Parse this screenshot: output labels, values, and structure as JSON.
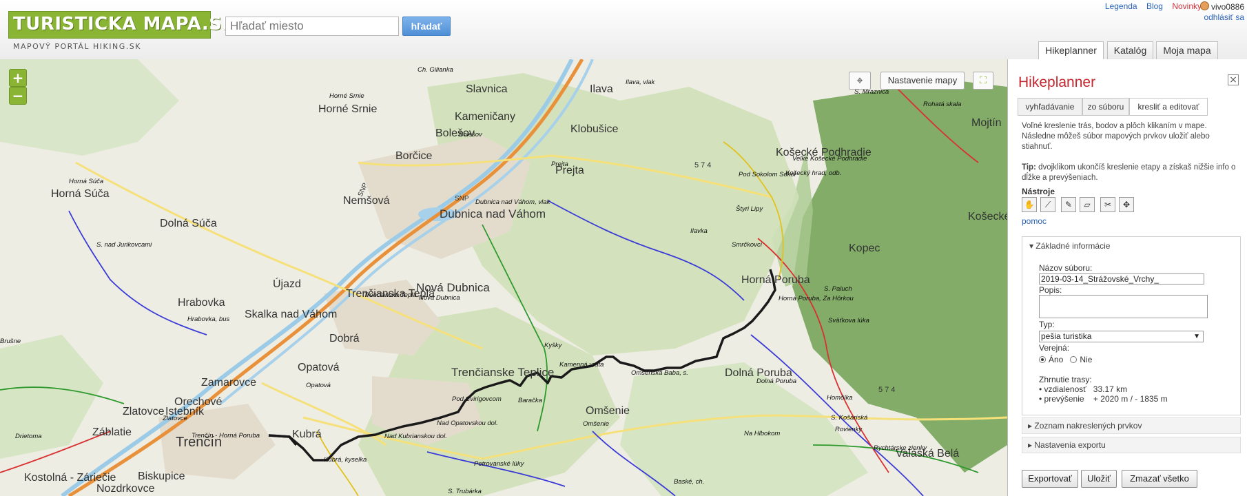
{
  "header": {
    "logo_text": "TURISTICKA MAPA.SK",
    "subtitle": "MAPOVÝ PORTÁL HIKING.SK",
    "search_placeholder": "Hľadať miesto",
    "search_button": "hľadať",
    "links": [
      "Legenda",
      "Blog",
      "Novinky"
    ],
    "user_name": "vivo0886",
    "logout": "odhlásiť sa",
    "tabs": [
      {
        "label": "Hikeplanner",
        "active": true
      },
      {
        "label": "Katalóg",
        "active": false
      },
      {
        "label": "Moja mapa",
        "active": false
      }
    ]
  },
  "map": {
    "zoom_in": "+",
    "zoom_out": "−",
    "settings_button": "Nastavenie mapy",
    "locate_icon": "crosshair-icon",
    "fullscreen_icon": "fullscreen-icon",
    "towns": [
      {
        "name": "Slavnica",
        "size": "big"
      },
      {
        "name": "Ilava",
        "size": "big"
      },
      {
        "name": "Horné Srnie",
        "size": "big"
      },
      {
        "name": "Kameničany",
        "size": "big"
      },
      {
        "name": "Klobušice",
        "size": "big"
      },
      {
        "name": "Bolešov",
        "size": "big"
      },
      {
        "name": "Borčice",
        "size": "big"
      },
      {
        "name": "Košecké Podhradie",
        "size": "big"
      },
      {
        "name": "Horná Súča",
        "size": "big"
      },
      {
        "name": "Nemšová",
        "size": "big"
      },
      {
        "name": "Dubnica nad Váhom",
        "size": "big"
      },
      {
        "name": "Prejta",
        "size": "big"
      },
      {
        "name": "Dolná Súča",
        "size": "big"
      },
      {
        "name": "Košecké",
        "size": "big"
      },
      {
        "name": "Kopec",
        "size": "big"
      },
      {
        "name": "Horná Poruba",
        "size": "big"
      },
      {
        "name": "Újazd",
        "size": "big"
      },
      {
        "name": "Nová Dubnica",
        "size": "big"
      },
      {
        "name": "Trenčianska Teplá",
        "size": "big"
      },
      {
        "name": "Hrabovka",
        "size": "big"
      },
      {
        "name": "Skalka nad Váhom",
        "size": "big"
      },
      {
        "name": "Dobrá",
        "size": "big"
      },
      {
        "name": "Opatová",
        "size": "big"
      },
      {
        "name": "Zamarovce",
        "size": "big"
      },
      {
        "name": "Trenčianske Teplice",
        "size": "big"
      },
      {
        "name": "Dolná Poruba",
        "size": "big"
      },
      {
        "name": "Orechové",
        "size": "big"
      },
      {
        "name": "Zlatovce",
        "size": "big"
      },
      {
        "name": "Istebník",
        "size": "big"
      },
      {
        "name": "Omšenie",
        "size": "big"
      },
      {
        "name": "Záblatie",
        "size": "big"
      },
      {
        "name": "Trenčín",
        "size": "big"
      },
      {
        "name": "Kubrá",
        "size": "big"
      },
      {
        "name": "Kostolná - Záriečie",
        "size": "big"
      },
      {
        "name": "Biskupice",
        "size": "big"
      },
      {
        "name": "Nozdrkovce",
        "size": "big"
      },
      {
        "name": "Valaská Belá",
        "size": "big"
      },
      {
        "name": "Mojtín",
        "size": "big"
      }
    ],
    "stops": [
      "Ch. Gilianka",
      "Ilava, vlak",
      "S. Mraznica",
      "Horné Srnie",
      "Rohatá skala",
      "Bolešov",
      "Prejta",
      "Velké Košecké Podhradie",
      "Košecký hrad, odb.",
      "Pod Sokolom Sokol",
      "Horná Súča",
      "Dubnica nad Váhom, vlak",
      "Štyri Lipy",
      "Ilavka",
      "Smrčkovci",
      "S. nad Jurikovcami",
      "S. Paluch",
      "Horná Poruba, Za Hôrkou",
      "Trenčianska Teplá",
      "Nová Dubnica",
      "Hrabovka, bus",
      "Sväťkova lúka",
      "Brušne",
      "Kyšky",
      "Kamenná vrata",
      "Omšenská Baba, s.",
      "Opatová",
      "Dolná Poruba",
      "Pod Cvirigovcom",
      "Baračka",
      "Homôlka",
      "Zlatovce",
      "Drietoma",
      "Trenčín - Horná Poruba",
      "Nad Opatovskou dol.",
      "Nad Kubrianskou dol.",
      "Omšenie",
      "S. Košariská",
      "Rovienky",
      "Kubrá, kyselka",
      "Petrovanské lúky",
      "Na Hlbokom",
      "Rychtárske zienky",
      "Baské, ch.",
      "S. Trubárka"
    ],
    "route_marks": [
      "SNP",
      "574"
    ]
  },
  "panel": {
    "title": "Hikeplanner",
    "close_icon": "close-icon",
    "tabs": [
      {
        "label": "vyhľadávanie",
        "active": false
      },
      {
        "label": "zo súboru",
        "active": false
      },
      {
        "label": "kresliť a editovať",
        "active": true
      }
    ],
    "intro": "Voľné kreslenie trás, bodov a plôch klikaním v mape. Následne môžeš súbor mapových prvkov uložiť alebo stiahnuť.",
    "tip_label": "Tip:",
    "tip_text": "dvojklikom ukončíš kreslenie etapy a získaš nižšie info o dĺžke a prevýšeniach.",
    "tools_label": "Nástroje",
    "tools": [
      "hand-icon",
      "polyline-icon",
      "draw-line-icon",
      "polygon-icon",
      "scissors-icon",
      "move-icon"
    ],
    "help": "pomoc",
    "basic_info": {
      "title": "Základné informácie",
      "file_name_label": "Názov súboru:",
      "file_name_value": "2019-03-14_Strážovské_Vrchy_",
      "description_label": "Popis:",
      "description_value": "",
      "type_label": "Typ:",
      "type_value": "pešia turistika",
      "public_label": "Verejná:",
      "public_yes": "Áno",
      "public_no": "Nie",
      "public_selected": "yes",
      "summary_label": "Zhrnutie trasy:",
      "distance_label": "• vzdialenosť",
      "distance_value": "33.17 km",
      "elevation_label": "• prevýšenie",
      "elevation_value": "+ 2020 m / - 1835 m"
    },
    "sections": [
      "Zoznam nakreslených prvkov",
      "Nastavenia exportu"
    ],
    "buttons": [
      "Exportovať",
      "Uložiť",
      "Zmazať všetko"
    ]
  }
}
